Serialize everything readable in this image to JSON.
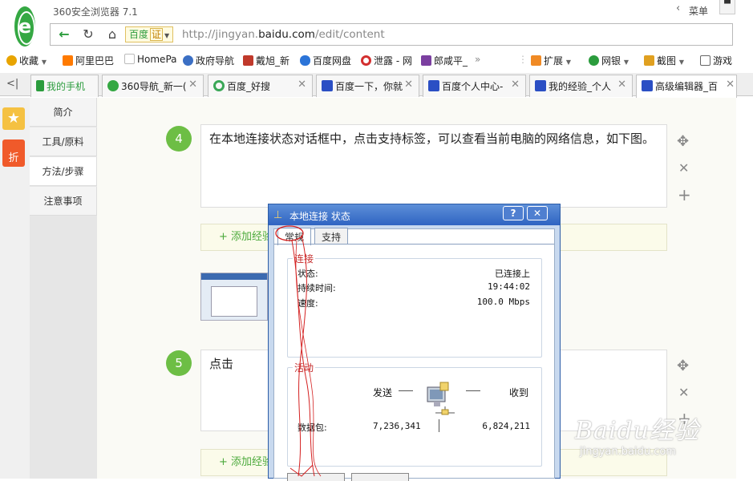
{
  "browser": {
    "app_title": "360安全浏览器 7.1",
    "menu_label": "菜单",
    "menu_chevron": "‹",
    "skin_icon": "shirt-icon",
    "search_engine": "百度",
    "search_engine_badge": "证",
    "url_prefix": "http://jingyan.",
    "url_domain": "baidu.com",
    "url_suffix": "/edit/content"
  },
  "bookmarks": [
    {
      "label": "收藏",
      "icon": "star-plus-icon",
      "color": "#e8a400"
    },
    {
      "label": "阿里巴巴",
      "icon": "alibaba-icon",
      "color": "#ff7a00"
    },
    {
      "label": "HomePa",
      "icon": "page-icon",
      "color": "#bbbbbb"
    },
    {
      "label": "政府导航",
      "icon": "globe-search-icon",
      "color": "#3b6fc4"
    },
    {
      "label": "戴旭_新",
      "icon": "bookmark-icon",
      "color": "#c0392b"
    },
    {
      "label": "百度网盘",
      "icon": "cloud-icon",
      "color": "#2b74d8"
    },
    {
      "label": "泄露 - 网",
      "icon": "opera-icon",
      "color": "#d32f2f"
    },
    {
      "label": "郎咸平_",
      "icon": "bookmark-icon",
      "color": "#7b3fa0"
    },
    {
      "label": "扩展",
      "icon": "puzzle-icon",
      "color": "#f08a24"
    },
    {
      "label": "网银",
      "icon": "shield-yen-icon",
      "color": "#2b9c3d"
    },
    {
      "label": "截图",
      "icon": "scissors-icon",
      "color": "#e0a020"
    },
    {
      "label": "游戏",
      "icon": "gamepad-icon",
      "color": "#666666"
    }
  ],
  "tabs": [
    {
      "label": "我的手机",
      "icon": "phone-icon",
      "color": "#2b9c3d"
    },
    {
      "label": "360导航_新一(",
      "icon": "360-icon",
      "color": "#35a843"
    },
    {
      "label": "百度_好搜",
      "icon": "haosou-icon",
      "color": "#3aa757"
    },
    {
      "label": "百度一下，你就",
      "icon": "baidu-paw-icon",
      "color": "#2b4fc4"
    },
    {
      "label": "百度个人中心-",
      "icon": "baidu-paw-icon",
      "color": "#2b4fc4"
    },
    {
      "label": "我的经验_个人",
      "icon": "baidu-paw-icon",
      "color": "#2b4fc4"
    },
    {
      "label": "高级编辑器_百",
      "icon": "baidu-paw-icon",
      "color": "#2b4fc4"
    }
  ],
  "side_nav": [
    "简介",
    "工具/原料",
    "方法/步骤",
    "注意事项"
  ],
  "steps": [
    {
      "number": "4",
      "text": "在本地连接状态对话框中，点击支持标签，可以查看当前电脑的网络信息，如下图。"
    },
    {
      "number": "5",
      "text": "点击"
    }
  ],
  "add_experience_label": "+ 添加经验",
  "dialog": {
    "title": "本地连接 状态",
    "help_label": "?",
    "close_label": "✕",
    "tabs": [
      "常规",
      "支持"
    ],
    "connection": {
      "title": "连接",
      "rows": [
        {
          "label": "状态:",
          "value": "已连接上"
        },
        {
          "label": "持续时间:",
          "value": "19:44:02"
        },
        {
          "label": "速度:",
          "value": "100.0 Mbps"
        }
      ]
    },
    "activity": {
      "title": "活动",
      "sent_label": "发送",
      "received_label": "收到",
      "packets_label": "数据包:",
      "sent_value": "7,236,341",
      "received_value": "6,824,211"
    }
  },
  "watermark": {
    "brand": "Baidu经验",
    "url": "jingyan.baidu.com"
  }
}
